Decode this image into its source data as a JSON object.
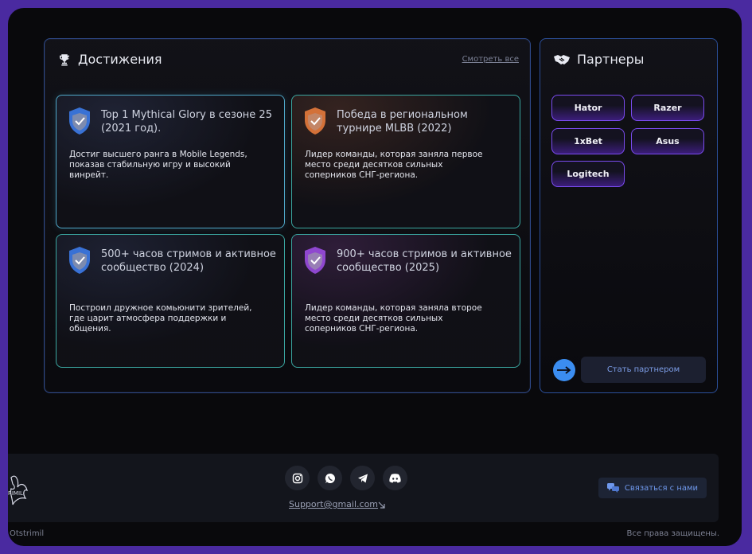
{
  "achievements": {
    "title": "Достижения",
    "see_all": "Смотреть все",
    "cards": [
      {
        "title": "Top 1 Mythical Glory в сезоне 25 (2021 год).",
        "description": "Достиг высшего ранга в Mobile Legends, показав стабильную игру и высокий винрейт.",
        "badge_color": "#3d7be8"
      },
      {
        "title": "Победа в региональном турнире MLBB (2022)",
        "description": "Лидер команды, которая заняла первое место среди десятков сильных соперников СНГ-региона.",
        "badge_color": "#e57a3c"
      },
      {
        "title": "500+ часов стримов и активное сообщество (2024)",
        "description": "Построил дружное комьюнити зрителей, где царит атмосфера поддержки и общения.",
        "badge_color": "#3d7be8"
      },
      {
        "title": "900+ часов стримов и активное сообщество (2025)",
        "description": "Лидер команды, которая заняла второе место среди десятков сильных соперников СНГ-региона.",
        "badge_color": "#9a4de0"
      }
    ]
  },
  "partners": {
    "title": "Партнеры",
    "items": [
      "Hator",
      "Razer",
      "1xBet",
      "Asus",
      "Logitech"
    ],
    "become_label": "Стать партнером"
  },
  "footer": {
    "email": "Support@gmail.com",
    "contact_label": "Связаться с нами",
    "social": [
      "instagram-icon",
      "whatsapp-icon",
      "telegram-icon",
      "discord-icon"
    ],
    "copyright_left": "Otstrimil",
    "copyright_right": "Все права защищены."
  },
  "colors": {
    "accent_blue": "#3b8df0",
    "accent_purple": "#7b4cf0",
    "background": "#09090c",
    "frame": "#4a2aa0"
  }
}
